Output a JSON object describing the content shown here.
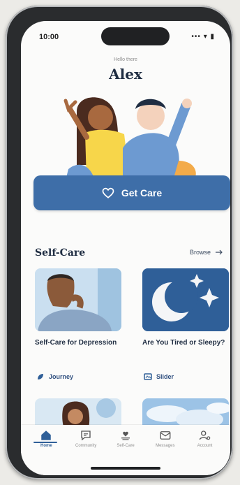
{
  "status_bar": {
    "time": "10:00",
    "icons": "••• ▾ ▮"
  },
  "header": {
    "greeting": "Hello there",
    "user_name": "Alex"
  },
  "cta": {
    "label": "Get Care",
    "icon": "heart-icon"
  },
  "self_care": {
    "title": "Self-Care",
    "browse_label": "Browse",
    "cards": [
      {
        "title": "Self-Care for Depression",
        "tag": "Journey",
        "tag_icon": "journey-icon"
      },
      {
        "title": "Are You Tired or Sleepy?",
        "tag": "Slider",
        "tag_icon": "slider-icon"
      }
    ]
  },
  "tabs": [
    {
      "label": "Home",
      "icon": "home-icon",
      "active": true
    },
    {
      "label": "Community",
      "icon": "chat-icon",
      "active": false
    },
    {
      "label": "Self-Care",
      "icon": "self-care-icon",
      "active": false
    },
    {
      "label": "Messages",
      "icon": "mail-icon",
      "active": false
    },
    {
      "label": "Account",
      "icon": "account-icon",
      "active": false
    }
  ],
  "colors": {
    "accent": "#3e6ea8",
    "primary_text": "#1f2d42",
    "sleep_card": "#2f5f98"
  }
}
